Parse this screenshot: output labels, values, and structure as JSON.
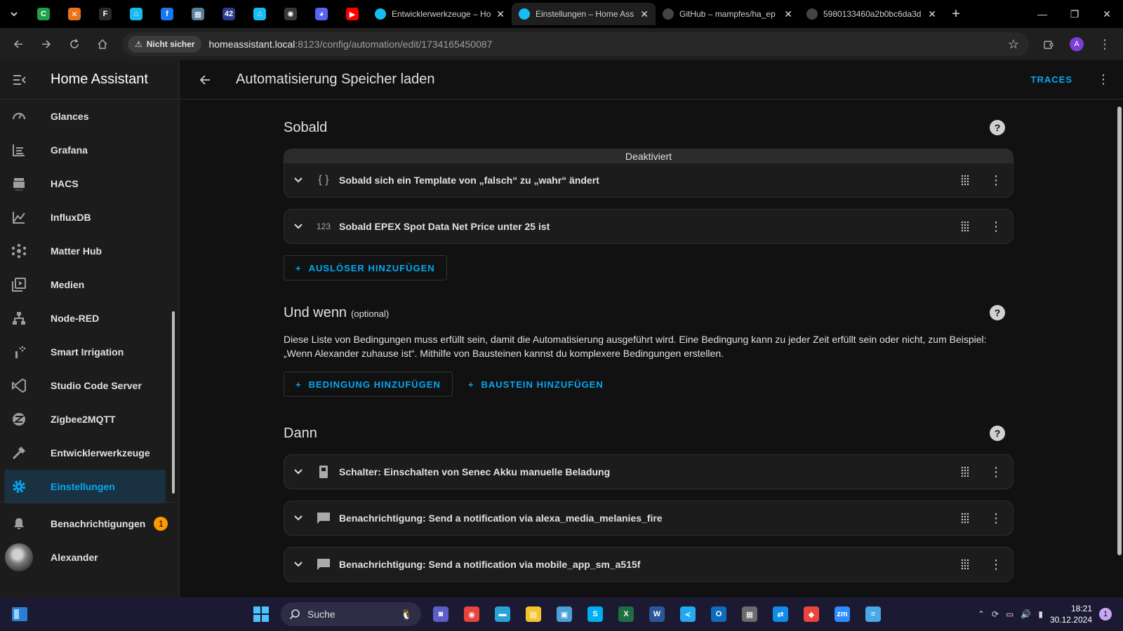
{
  "browser": {
    "pinned_tabs": [
      {
        "icon": "green-app-icon",
        "color": "#1fa04a",
        "label": "C"
      },
      {
        "icon": "orange-x-icon",
        "color": "#e8731c",
        "label": "✕"
      },
      {
        "icon": "f-icon",
        "color": "#2b2b2b",
        "label": "F"
      },
      {
        "icon": "home-assistant-icon",
        "color": "#18bcf2",
        "label": "⌂"
      },
      {
        "icon": "facebook-icon",
        "color": "#1877f2",
        "label": "f"
      },
      {
        "icon": "image-app-icon",
        "color": "#5a7d9a",
        "label": "▦"
      },
      {
        "icon": "circle-42-icon",
        "color": "#2c3e8f",
        "label": "42"
      },
      {
        "icon": "home-assistant-icon",
        "color": "#18bcf2",
        "label": "⌂"
      },
      {
        "icon": "openai-icon",
        "color": "#3a3a3a",
        "label": "✺"
      },
      {
        "icon": "discord-icon",
        "color": "#5865f2",
        "label": "◕"
      },
      {
        "icon": "youtube-icon",
        "color": "#ff0000",
        "label": "▶"
      }
    ],
    "tabs": [
      {
        "title": "Entwicklerwerkzeuge – Ho",
        "icon": "home-assistant-icon",
        "active": false
      },
      {
        "title": "Einstellungen – Home Ass",
        "icon": "home-assistant-icon",
        "active": true
      },
      {
        "title": "GitHub – mampfes/ha_ep",
        "icon": "github-icon",
        "active": false
      },
      {
        "title": "5980133460a2b0bc6da3d",
        "icon": "globe-icon",
        "active": false
      }
    ],
    "security_label": "Nicht sicher",
    "url_host": "homeassistant.local",
    "url_path": ":8123/config/automation/edit/1734165450087",
    "profile_initial": "A"
  },
  "sidebar": {
    "title": "Home Assistant",
    "items": [
      {
        "label": "Glances",
        "icon": "speedometer-icon"
      },
      {
        "label": "Grafana",
        "icon": "chart-lines-icon"
      },
      {
        "label": "HACS",
        "icon": "hacs-icon"
      },
      {
        "label": "InfluxDB",
        "icon": "chart-area-icon"
      },
      {
        "label": "Matter Hub",
        "icon": "hub-icon"
      },
      {
        "label": "Medien",
        "icon": "media-icon"
      },
      {
        "label": "Node-RED",
        "icon": "sitemap-icon"
      },
      {
        "label": "Smart Irrigation",
        "icon": "sprinkler-icon"
      },
      {
        "label": "Studio Code Server",
        "icon": "vscode-icon"
      },
      {
        "label": "Zigbee2MQTT",
        "icon": "zigbee-icon"
      },
      {
        "label": "Entwicklerwerkzeuge",
        "icon": "hammer-icon"
      },
      {
        "label": "Einstellungen",
        "icon": "gear-icon",
        "active": true
      }
    ],
    "notifications_label": "Benachrichtigungen",
    "notifications_count": "1",
    "user_name": "Alexander"
  },
  "header": {
    "title": "Automatisierung Speicher laden",
    "traces_label": "TRACES"
  },
  "triggers": {
    "heading": "Sobald",
    "disabled_label": "Deaktiviert",
    "items": [
      {
        "text": "Sobald sich ein Template von „falsch“ zu „wahr“ ändert",
        "icon_text": "{ }"
      },
      {
        "text": "Sobald EPEX Spot Data Net Price unter 25 ist",
        "icon_text": "123"
      }
    ],
    "add_label": "AUSLÖSER HINZUFÜGEN"
  },
  "conditions": {
    "heading": "Und wenn",
    "optional_label": "(optional)",
    "description": "Diese Liste von Bedingungen muss erfüllt sein, damit die Automatisierung ausgeführt wird. Eine Bedingung kann zu jeder Zeit erfüllt sein oder nicht, zum Beispiel: „Wenn Alexander zuhause ist“. Mithilfe von Bausteinen kannst du komplexere Bedingungen erstellen.",
    "add_condition_label": "BEDINGUNG HINZUFÜGEN",
    "add_building_block_label": "BAUSTEIN HINZUFÜGEN"
  },
  "actions": {
    "heading": "Dann",
    "items": [
      {
        "text": "Schalter: Einschalten von Senec Akku manuelle Beladung",
        "icon": "switch-icon"
      },
      {
        "text": "Benachrichtigung: Send a notification via alexa_media_melanies_fire",
        "icon": "message-icon"
      },
      {
        "text": "Benachrichtigung: Send a notification via mobile_app_sm_a515f",
        "icon": "message-icon"
      }
    ]
  },
  "taskbar": {
    "search_label": "Suche",
    "time": "18:21",
    "date": "30.12.2024",
    "notification_count": "1"
  },
  "colors": {
    "accent": "#03a9f4",
    "badge": "#ff9800",
    "active_item_bg": "#1a3141"
  }
}
